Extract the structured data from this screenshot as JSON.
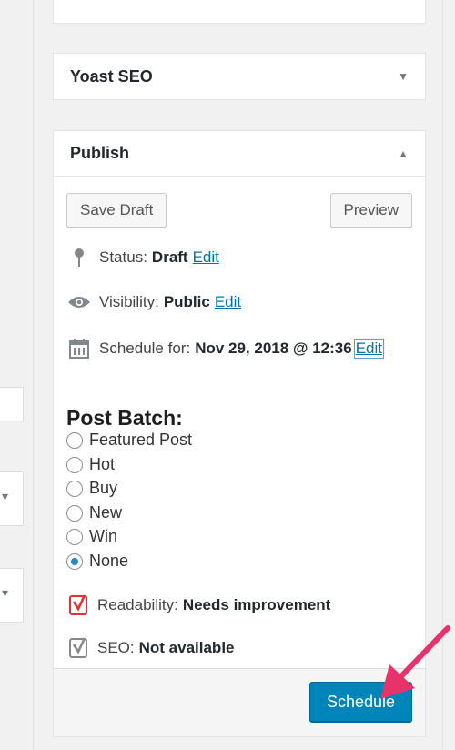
{
  "yoast_box": {
    "title": "Yoast SEO"
  },
  "publish_box": {
    "title": "Publish",
    "save_draft": "Save Draft",
    "preview": "Preview",
    "status": {
      "label": "Status:",
      "value": "Draft",
      "edit": "Edit"
    },
    "visibility": {
      "label": "Visibility:",
      "value": "Public",
      "edit": "Edit"
    },
    "schedule": {
      "label": "Schedule for:",
      "value": "Nov 29, 2018 @ 12:36",
      "edit": "Edit"
    },
    "post_batch": {
      "title": "Post Batch:",
      "options": [
        "Featured Post",
        "Hot",
        "Buy",
        "New",
        "Win",
        "None"
      ],
      "selected": "None"
    },
    "readability": {
      "label": "Readability:",
      "value": "Needs improvement"
    },
    "seo": {
      "label": "SEO:",
      "value": "Not available"
    },
    "schedule_button": "Schedule"
  },
  "colors": {
    "accent": "#0085ba",
    "arrow": "#e8336a",
    "link": "#0073aa"
  },
  "icons": [
    "pin-icon",
    "eye-icon",
    "calendar-icon",
    "yoast-readability-icon",
    "yoast-seo-icon",
    "caret-down-icon",
    "caret-up-icon"
  ]
}
